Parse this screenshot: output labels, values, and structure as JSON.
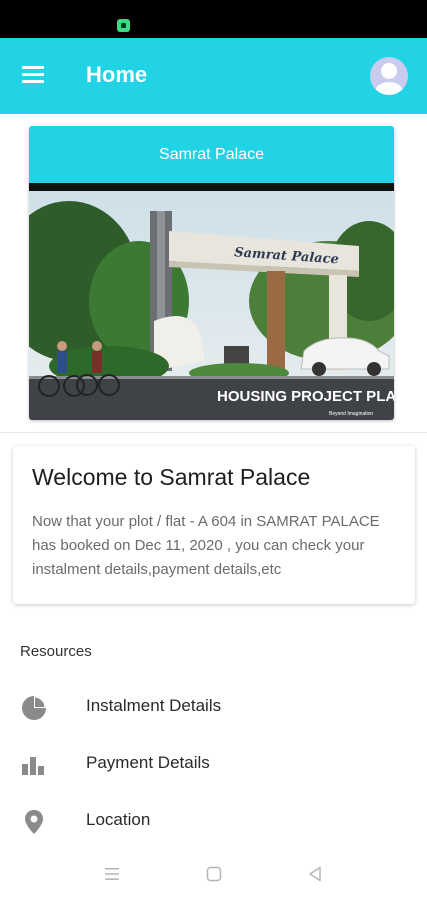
{
  "app_bar": {
    "title": "Home",
    "color": "#22d3e6"
  },
  "banner": {
    "title": "Samrat Palace",
    "image_text": {
      "gate_sign": "Samrat Palace",
      "headline": "HOUSING PROJECT PLAN",
      "tagline": "Beyond Imagination"
    }
  },
  "welcome": {
    "title": "Welcome to Samrat Palace",
    "message": "Now that your plot / flat - A 604 in SAMRAT PALACE has booked on Dec 11, 2020 , you can check your instalment details,payment details,etc"
  },
  "resources": {
    "heading": "Resources",
    "items": [
      {
        "label": "Instalment Details",
        "icon": "pie-chart-icon"
      },
      {
        "label": "Payment Details",
        "icon": "bar-chart-icon"
      },
      {
        "label": "Location",
        "icon": "location-pin-icon"
      }
    ]
  },
  "icons": {
    "menu": "menu-icon",
    "avatar": "account-circle-icon",
    "nav": [
      "recent-apps-icon",
      "home-icon",
      "back-icon"
    ]
  }
}
